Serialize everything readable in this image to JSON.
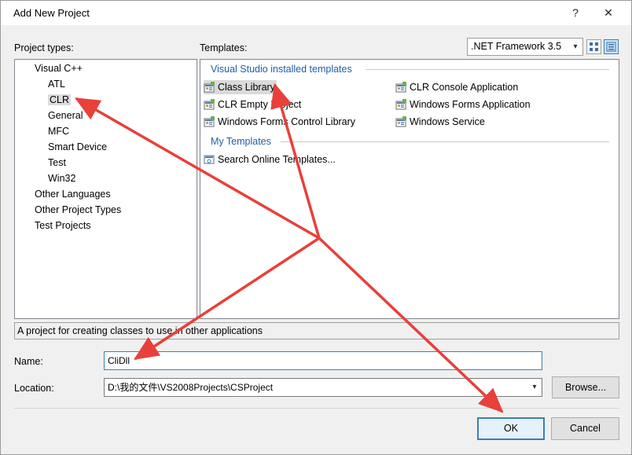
{
  "window": {
    "title": "Add New Project",
    "help": "?",
    "close": "✕"
  },
  "project_types": {
    "label": "Project types:",
    "items": [
      {
        "label": "Visual C++",
        "level": 0,
        "selected": false
      },
      {
        "label": "ATL",
        "level": 1,
        "selected": false
      },
      {
        "label": "CLR",
        "level": 1,
        "selected": true
      },
      {
        "label": "General",
        "level": 1,
        "selected": false
      },
      {
        "label": "MFC",
        "level": 1,
        "selected": false
      },
      {
        "label": "Smart Device",
        "level": 1,
        "selected": false
      },
      {
        "label": "Test",
        "level": 1,
        "selected": false
      },
      {
        "label": "Win32",
        "level": 1,
        "selected": false
      },
      {
        "label": "Other Languages",
        "level": 0,
        "selected": false
      },
      {
        "label": "Other Project Types",
        "level": 0,
        "selected": false
      },
      {
        "label": "Test Projects",
        "level": 0,
        "selected": false
      }
    ]
  },
  "templates": {
    "label": "Templates:",
    "framework": ".NET Framework 3.5",
    "installed_header": "Visual Studio installed templates",
    "installed": [
      {
        "label": "Class Library",
        "selected": true
      },
      {
        "label": "CLR Console Application",
        "selected": false
      },
      {
        "label": "CLR Empty Project",
        "selected": false
      },
      {
        "label": "Windows Forms Application",
        "selected": false
      },
      {
        "label": "Windows Forms Control Library",
        "selected": false
      },
      {
        "label": "Windows Service",
        "selected": false
      }
    ],
    "my_header": "My Templates",
    "my": [
      {
        "label": "Search Online Templates..."
      }
    ]
  },
  "description": "A project for creating classes to use in other applications",
  "name": {
    "label": "Name:",
    "value": "CliDll"
  },
  "location": {
    "label": "Location:",
    "value": "D:\\我的文件\\VS2008Projects\\CSProject",
    "browse": "Browse..."
  },
  "buttons": {
    "ok": "OK",
    "cancel": "Cancel"
  },
  "colors": {
    "accent": "#3c7fb1",
    "section_header": "#1f5ea8",
    "annotation_arrow": "#e8403a"
  }
}
